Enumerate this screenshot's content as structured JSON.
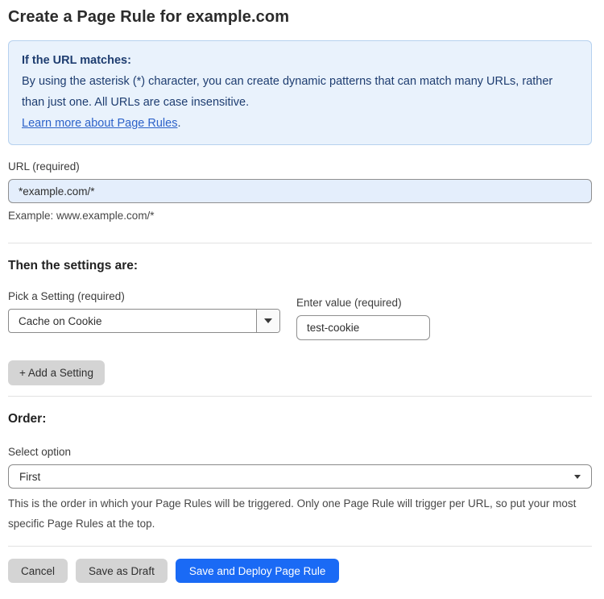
{
  "page": {
    "title": "Create a Page Rule for example.com"
  },
  "info_box": {
    "heading": "If the URL matches:",
    "body": "By using the asterisk (*) character, you can create dynamic patterns that can match many URLs, rather than just one. All URLs are case insensitive.",
    "link_label": "Learn more about Page Rules",
    "link_suffix": "."
  },
  "url_field": {
    "label": "URL (required)",
    "value": "*example.com/*",
    "helper": "Example: www.example.com/*"
  },
  "settings_section": {
    "heading": "Then the settings are:",
    "setting_select": {
      "label": "Pick a Setting (required)",
      "value": "Cache on Cookie"
    },
    "value_input": {
      "label": "Enter value (required)",
      "value": "test-cookie"
    },
    "add_setting_label": "+ Add a Setting"
  },
  "order_section": {
    "heading": "Order:",
    "select_label": "Select option",
    "selected_option": "First",
    "helper": "This is the order in which your Page Rules will be triggered. Only one Page Rule will trigger per URL, so put your most specific Page Rules at the top."
  },
  "footer": {
    "cancel_label": "Cancel",
    "save_draft_label": "Save as Draft",
    "save_deploy_label": "Save and Deploy Page Rule"
  },
  "colors": {
    "primary_blue": "#1a6af5",
    "info_bg": "#e9f2fc",
    "info_border": "#b6d1ef",
    "info_text": "#1e3d70",
    "link_blue": "#2c62c9",
    "input_blue_bg": "#e4eefc",
    "button_gray": "#d4d4d4"
  }
}
